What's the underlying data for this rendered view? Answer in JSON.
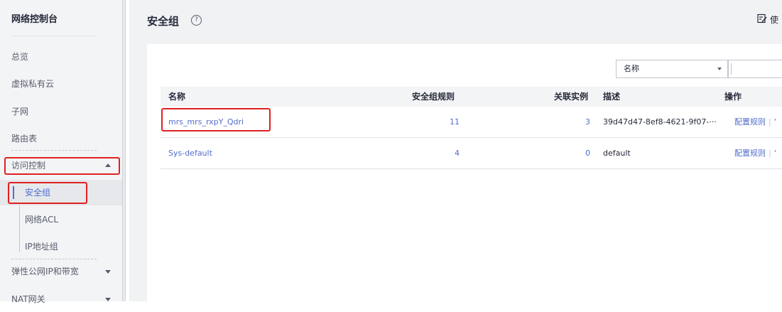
{
  "sidebar": {
    "title": "网络控制台",
    "items": {
      "overview": "总览",
      "vpc": "虚拟私有云",
      "subnet": "子网",
      "route_table": "路由表",
      "access_control": "访问控制",
      "security_group": "安全组",
      "network_acl": "网络ACL",
      "ip_group": "IP地址组",
      "eip": "弹性公网IP和带宽",
      "nat": "NAT网关"
    }
  },
  "page": {
    "title": "安全组",
    "help_glyph": "?",
    "guide_label": "使"
  },
  "filter": {
    "selected": "名称",
    "value": ""
  },
  "table": {
    "columns": {
      "name": "名称",
      "rules": "安全组规则",
      "instances": "关联实例",
      "description": "描述",
      "actions": "操作"
    },
    "rows": [
      {
        "name": "mrs_mrs_rxpY_Qdri",
        "rules": "11",
        "instances": "3",
        "description": "39d47d47-8ef8-4621-9f07-···",
        "action": "配置规则",
        "sep": "|",
        "more": "‘"
      },
      {
        "name": "Sys-default",
        "rules": "4",
        "instances": "0",
        "description": "default",
        "action": "配置规则",
        "sep": "|",
        "more": "‘"
      }
    ]
  },
  "colors": {
    "accent": "#526ecc",
    "highlight": "#e02020"
  },
  "icons": [
    "help-icon",
    "guide-icon",
    "caret-up-icon",
    "caret-down-icon"
  ]
}
